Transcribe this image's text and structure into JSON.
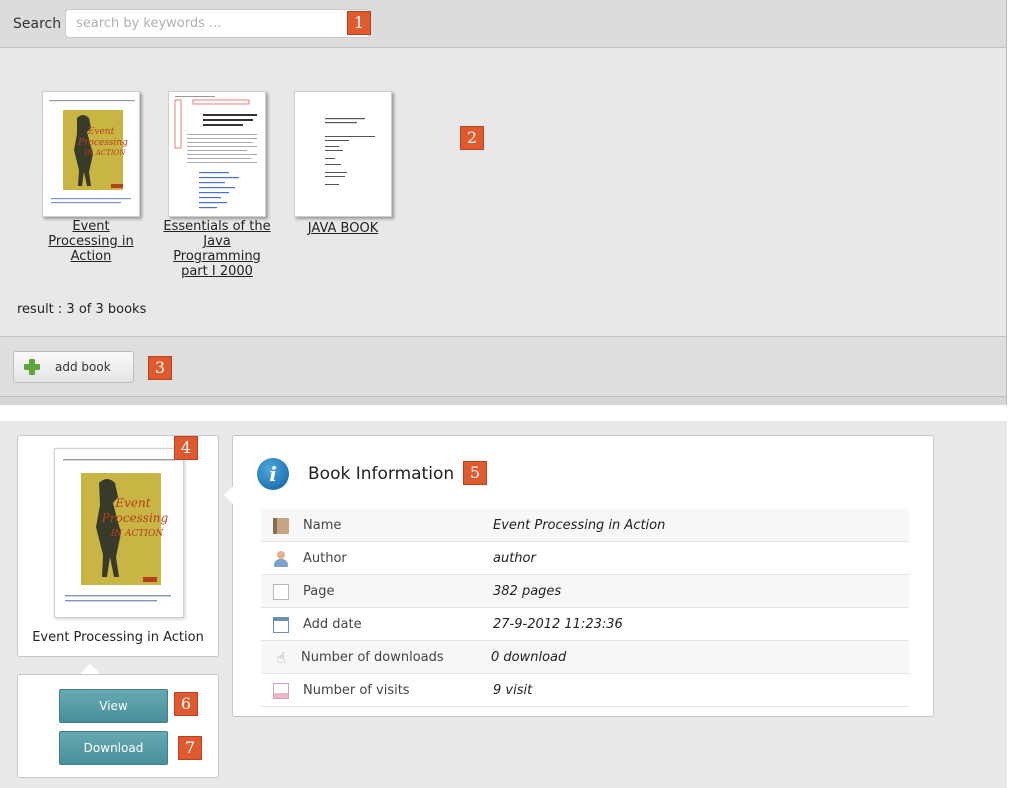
{
  "search": {
    "label": "Search",
    "placeholder": "search by keywords ...",
    "value": ""
  },
  "books": [
    {
      "title": "Event Processing in Action",
      "cover": "event-processing-cover"
    },
    {
      "title": "Essentials of the Java Programming part I 2000",
      "cover": "java-essentials-cover"
    },
    {
      "title": "JAVA BOOK",
      "cover": "java-book-cover"
    }
  ],
  "result_text": "result : 3 of 3 books",
  "add_book_label": "add book",
  "detail": {
    "cover_caption": "Event Processing in Action",
    "view_label": "View",
    "download_label": "Download",
    "info_title": "Book Information",
    "rows": [
      {
        "icon": "book-icon",
        "label": "Name",
        "value": "Event Processing in Action"
      },
      {
        "icon": "author-icon",
        "label": "Author",
        "value": "author"
      },
      {
        "icon": "page-icon",
        "label": "Page",
        "value": "382 pages"
      },
      {
        "icon": "calendar-icon",
        "label": "Add date",
        "value": "27-9-2012 11:23:36"
      },
      {
        "icon": "hand-icon",
        "label": "Number of downloads",
        "value": "0 download"
      },
      {
        "icon": "chart-icon",
        "label": "Number of visits",
        "value": "9 visit"
      }
    ]
  },
  "cover_art": {
    "event_title_lines": [
      "Event",
      "Processing",
      "IN ACTION"
    ]
  },
  "markers": [
    "1",
    "2",
    "3",
    "4",
    "5",
    "6",
    "7"
  ],
  "colors": {
    "marker": "#e05a2f",
    "button_teal": "#56999f",
    "add_icon": "#5fa53c",
    "info_icon": "#1b6fae",
    "cover_yellow": "#c9b544",
    "cover_title": "#b5401d"
  }
}
